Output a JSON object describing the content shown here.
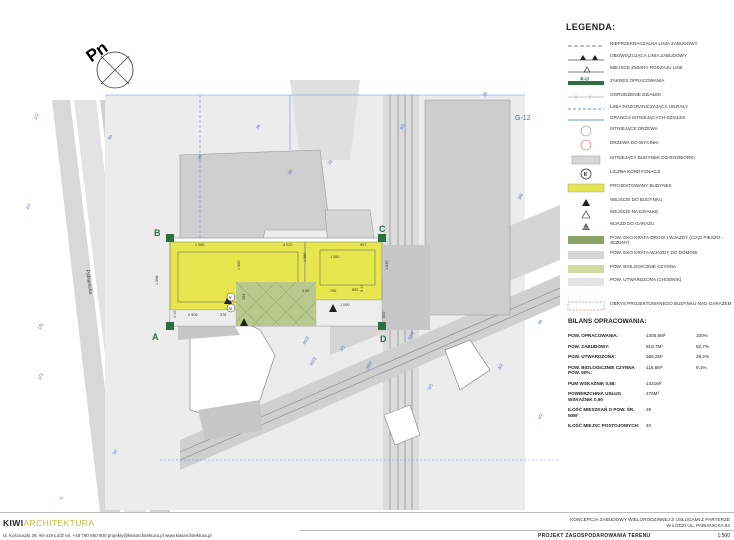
{
  "plan": {
    "north_label": "Pn",
    "street_label": "Pabianicka",
    "plot_numbers": [
      "1/2",
      "8a",
      "39",
      "5",
      "1/5",
      "2/2",
      "29",
      "30",
      "1/3",
      "32",
      "31",
      "25",
      "3/8",
      "3/1",
      "36",
      "3/2",
      "50/2",
      "5/1",
      "39/2",
      "40/2",
      "43/3",
      "8/1",
      "4/2"
    ],
    "road_label": "G-12",
    "corner_labels": {
      "a": "A",
      "b": "B",
      "c": "C",
      "d": "D"
    },
    "dimensions": [
      "1 080",
      "3 022",
      "907",
      "1 080",
      "1 000",
      "1 080",
      "3 00",
      "796",
      "892",
      "2 906",
      "378",
      "1 090",
      "1 645",
      "5 14",
      "1 008",
      "354",
      "4 10",
      "500"
    ],
    "marks": [
      "V",
      "IV"
    ],
    "colors": {
      "building": "#e7e64e",
      "paving": "#b9c98e",
      "shadow": "#c9c9c9",
      "grid": "#bfbfbf",
      "zone": "#2d6e43"
    }
  },
  "legend": {
    "title": "LEGENDA:",
    "boundary_label": "A-D",
    "items": [
      {
        "label": "NIEPRZEKRACZALNA LINIA ZABUDOWY",
        "symbol": "dash-line"
      },
      {
        "label": "OBOWIĄZUJĄCA LINIA ZABUDOWY",
        "symbol": "triangle-line"
      },
      {
        "label": "MIEJSCE ZMIANY RODZAJU LINII",
        "symbol": "triangle-outline-line"
      },
      {
        "label": "ZAKRES OPRACOWANIA",
        "symbol": "green-band"
      },
      {
        "label": "OGRODZENIE DZIAŁEK",
        "symbol": "fence-line"
      },
      {
        "label": "LINIA ROZGRANICZAJĄCA UDZIAŁY",
        "symbol": "blue-dash"
      },
      {
        "label": "GRANICA ISTNIEJĄCYCH DZIAŁEK",
        "symbol": "blue-line"
      },
      {
        "label": "ISTNIEJĄCE DRZEWA",
        "symbol": "tree-circle"
      },
      {
        "label": "DRZEWA DO WYCINKI",
        "symbol": "tree-red"
      },
      {
        "label": "ISTNIEJĄCY BUDYNEK DO ROZBIÓRKI",
        "symbol": "grey-box"
      },
      {
        "label": "LICZBA KONDYGNACJI",
        "symbol": "roman-circle"
      },
      {
        "label": "PROJEKTOWANY BUDYNEK",
        "symbol": "yellow-box"
      },
      {
        "label": "WEJŚCIE DO BUDYNKU",
        "symbol": "triangle-solid"
      },
      {
        "label": "WEJŚCIE NA DZIAŁKĘ",
        "symbol": "triangle-outline"
      },
      {
        "label": "WJAZD DO GARAŻU",
        "symbol": "triangle-hatched"
      },
      {
        "label": "POW. EKO KRATA-DROGI I WJAZDY (CIĄG PIESZO - JEZDNY)",
        "symbol": "green-box"
      },
      {
        "label": "POW. EKO KRATA-WJAZDY DO DOMÓW",
        "symbol": "lightgrey-box"
      },
      {
        "label": "POW. BIOLOGICZNIE CZYNNA",
        "symbol": "lightgreen-box"
      },
      {
        "label": "POW. UTWARDZONA (CHODNIK)",
        "symbol": "grey2-box"
      },
      {
        "label": "OBRYS PROJEKTOWANEGO BUDYNKU NAD GARAŻEM",
        "symbol": "red-dash-box"
      }
    ],
    "roman_symbol": "II"
  },
  "balance": {
    "title": "BILANS OPRACOWANIA:",
    "rows": [
      {
        "label": "POW. OPRACOWANIA:",
        "value": "1306,6m²",
        "percent": "100%"
      },
      {
        "label": "POW. ZABUDOWY:",
        "value": "818,7m²",
        "percent": "62,7%"
      },
      {
        "label": "POW. UTWARDZONA:",
        "value": "368,2m²",
        "percent": "28,2%"
      },
      {
        "label": "POW. BIOLOGICZNIE CZYNNA POW. 50%:",
        "value": "118,6m²",
        "percent": "9,1%"
      },
      {
        "label": "PUM WSKAŹNIK 0,68:",
        "value": "1421m²",
        "percent": ""
      },
      {
        "label": "POWIERZCHNIA USŁUG WSKAŹNIK 0,90",
        "value": "276m²",
        "percent": ""
      },
      {
        "label": "ILOŚĆ MIESZKAŃ O POW. ŚR. 50M²",
        "value": "29",
        "percent": ""
      },
      {
        "label": "ILOŚĆ MIEJSC POSTOJOWYCH:",
        "value": "40",
        "percent": ""
      }
    ]
  },
  "footer": {
    "logo_kiwi": "KIWI",
    "logo_arch": "ARCHITEKTURA",
    "contact": "ul. Kościuszki 28, 90-419 Łódź  tel. +48 790 950 900  projekty@kiwiarchitektura.pl  www.kiwiarchitektura.pl",
    "project_line1": "KONCEPCJA ZABUDOWY WIELORODZINNEJ Z USŁUGAMI Z PARTERZE",
    "project_line2": "W ŁODZI UL. PABIANICKA 52",
    "plan_title": "PROJEKT ZAGOSPODAROWANIA TERENU",
    "scale": "1:500"
  }
}
